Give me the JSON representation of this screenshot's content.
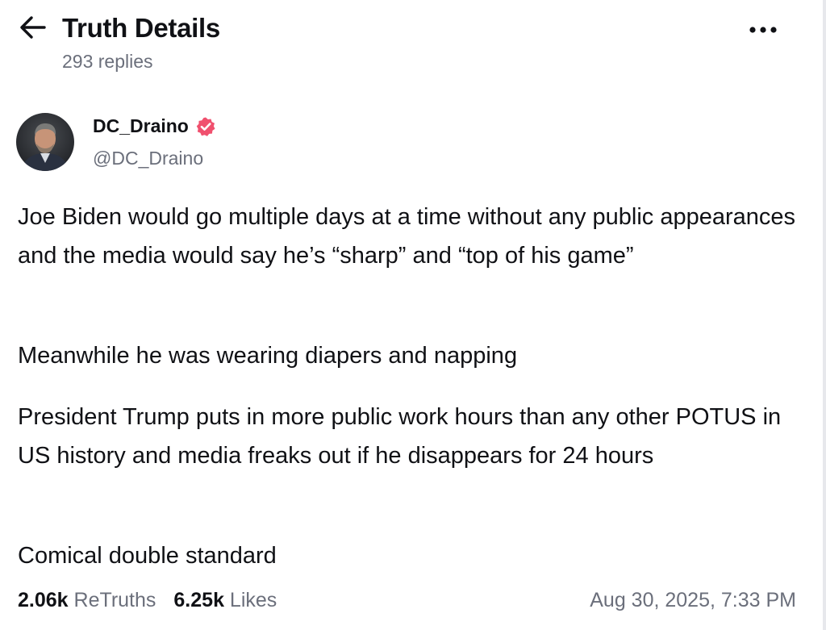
{
  "header": {
    "back_icon": "arrow-left-icon",
    "title": "Truth Details",
    "subtitle": "293 replies",
    "more_icon": "more-horizontal-icon"
  },
  "author": {
    "avatar_icon": "user-avatar",
    "display_name": "DC_Draino",
    "verified_icon": "verified-badge-icon",
    "verified_color": "#f0506e",
    "handle": "@DC_Draino"
  },
  "post": {
    "paragraphs": [
      "Joe Biden would go multiple days at a time without any public appearances and the media would say he’s “sharp” and “top of his game”",
      "Meanwhile he was wearing diapers and napping",
      "President Trump puts in more public work hours than any other POTUS in US history and media freaks out if he disappears for 24 hours",
      "Comical double standard"
    ]
  },
  "stats": {
    "retruths_count": "2.06k",
    "retruths_label": "ReTruths",
    "likes_count": "6.25k",
    "likes_label": "Likes",
    "timestamp": "Aug 30, 2025, 7:33 PM"
  },
  "colors": {
    "text_primary": "#101115",
    "text_secondary": "#6b6f7b",
    "accent": "#f0506e"
  }
}
